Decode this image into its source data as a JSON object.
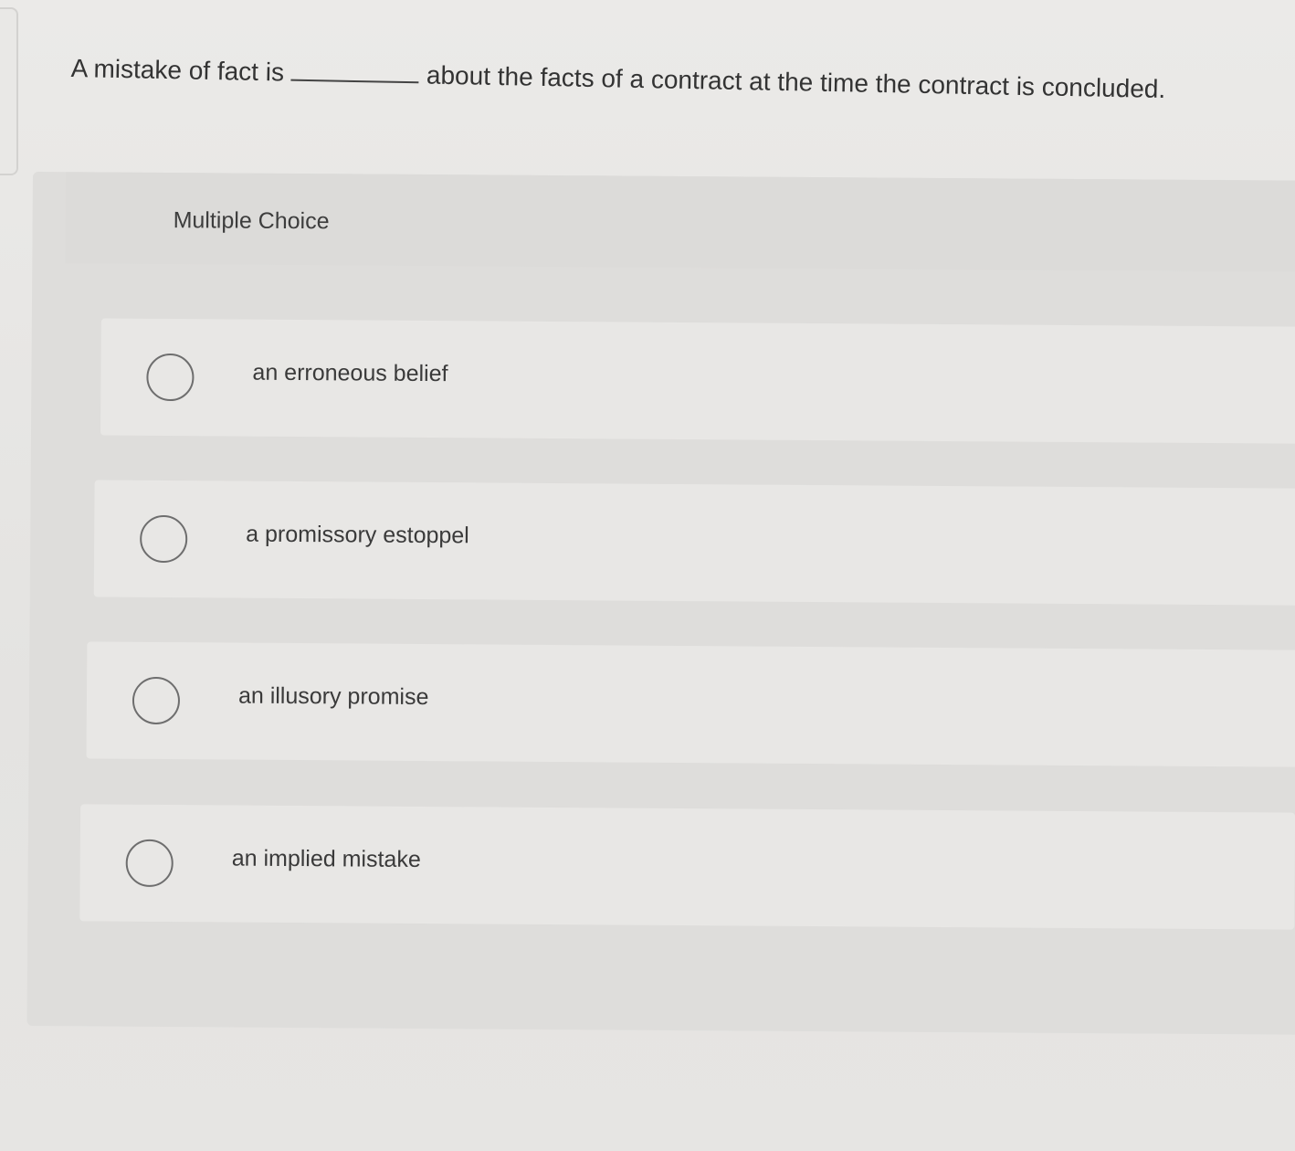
{
  "question": {
    "before_blank": "A mistake of fact is",
    "after_blank": "about the facts of a contract at the time the contract is concluded."
  },
  "multiple_choice": {
    "label": "Multiple Choice",
    "options": [
      {
        "label": "an erroneous belief"
      },
      {
        "label": "a promissory estoppel"
      },
      {
        "label": "an illusory promise"
      },
      {
        "label": "an implied mistake"
      }
    ]
  },
  "colors": {
    "background": "#e6e5e3",
    "panel": "#dedddb",
    "option_row": "#e8e7e5",
    "radio_border": "#6e6e6e",
    "text": "#333333"
  }
}
